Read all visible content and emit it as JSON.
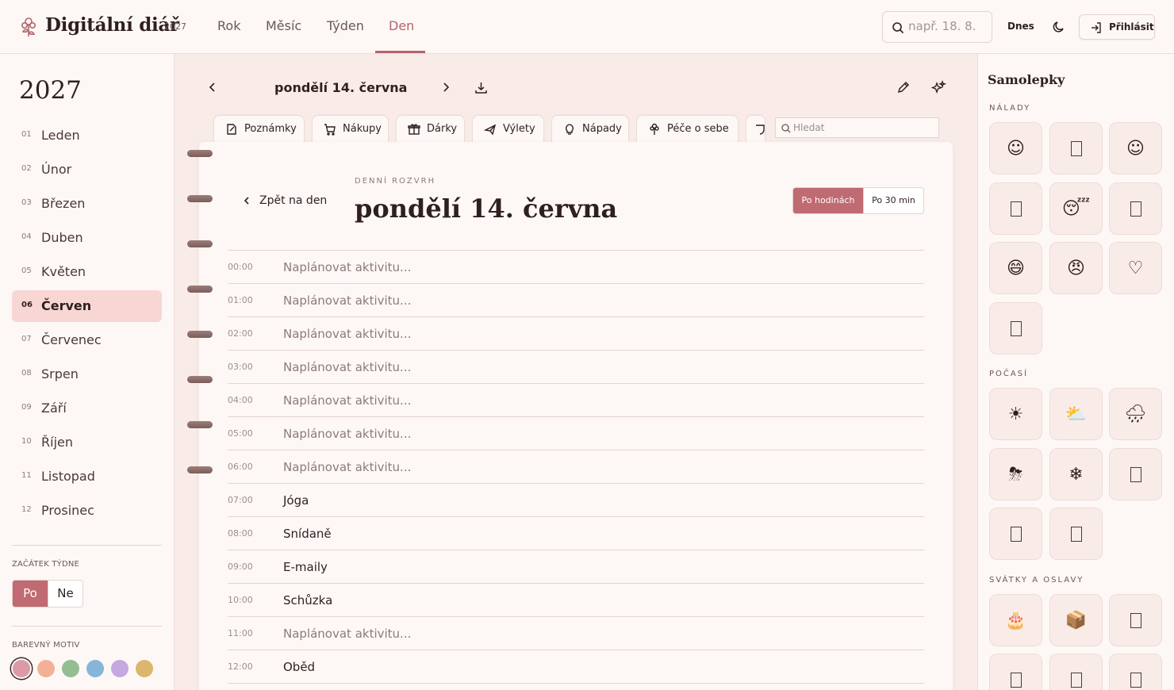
{
  "app": {
    "title": "Digitální diář",
    "year_badge": "2027",
    "nav": [
      "Rok",
      "Měsíc",
      "Týden",
      "Den"
    ],
    "active_nav": "Den",
    "search_placeholder": "např. 18. 8.",
    "today_label": "Dnes",
    "login_label": "Přihlásit"
  },
  "sidebar": {
    "year": "2027",
    "months": [
      {
        "num": "01",
        "name": "Leden"
      },
      {
        "num": "02",
        "name": "Únor"
      },
      {
        "num": "03",
        "name": "Březen"
      },
      {
        "num": "04",
        "name": "Duben"
      },
      {
        "num": "05",
        "name": "Květen"
      },
      {
        "num": "06",
        "name": "Červen"
      },
      {
        "num": "07",
        "name": "Červenec"
      },
      {
        "num": "08",
        "name": "Srpen"
      },
      {
        "num": "09",
        "name": "Září"
      },
      {
        "num": "10",
        "name": "Říjen"
      },
      {
        "num": "11",
        "name": "Listopad"
      },
      {
        "num": "12",
        "name": "Prosinec"
      }
    ],
    "active_month": "Červen",
    "week_start_label": "ZAČÁTEK TÝDNE",
    "week_start_options": [
      "Po",
      "Ne"
    ],
    "week_start_selected": "Po",
    "theme_label": "BAREVNÝ MOTIV",
    "theme_colors": [
      "#dc9aa4",
      "#f3b096",
      "#94bd92",
      "#85b6d9",
      "#c4a8df",
      "#dcb66c"
    ],
    "theme_selected": "#dc9aa4"
  },
  "main": {
    "date_header": "pondělí 14. června",
    "tabs": [
      {
        "label": "Poznámky",
        "icon": "note-icon"
      },
      {
        "label": "Nákupy",
        "icon": "cart-icon"
      },
      {
        "label": "Dárky",
        "icon": "gift-icon"
      },
      {
        "label": "Výlety",
        "icon": "plane-icon"
      },
      {
        "label": "Nápady",
        "icon": "bulb-icon"
      },
      {
        "label": "Péče o sebe",
        "icon": "flower-icon"
      }
    ],
    "tab_search_placeholder": "Hledat",
    "back_label": "Zpět na den",
    "eyebrow": "DENNÍ ROZVRH",
    "big_date": "pondělí 14. června",
    "slot_options": [
      "Po hodinách",
      "Po 30 min"
    ],
    "slot_selected": "Po hodinách",
    "schedule": [
      {
        "time": "00:00",
        "text": "Naplánovat aktivitu...",
        "filled": false
      },
      {
        "time": "01:00",
        "text": "Naplánovat aktivitu...",
        "filled": false
      },
      {
        "time": "02:00",
        "text": "Naplánovat aktivitu...",
        "filled": false
      },
      {
        "time": "03:00",
        "text": "Naplánovat aktivitu...",
        "filled": false
      },
      {
        "time": "04:00",
        "text": "Naplánovat aktivitu...",
        "filled": false
      },
      {
        "time": "05:00",
        "text": "Naplánovat aktivitu...",
        "filled": false
      },
      {
        "time": "06:00",
        "text": "Naplánovat aktivitu...",
        "filled": false
      },
      {
        "time": "07:00",
        "text": "Jóga",
        "filled": true
      },
      {
        "time": "08:00",
        "text": "Snídaně",
        "filled": true
      },
      {
        "time": "09:00",
        "text": "E-maily",
        "filled": true
      },
      {
        "time": "10:00",
        "text": "Schůzka",
        "filled": true
      },
      {
        "time": "11:00",
        "text": "Naplánovat aktivitu...",
        "filled": false
      },
      {
        "time": "12:00",
        "text": "Oběd",
        "filled": true
      }
    ]
  },
  "stickers": {
    "title": "Samolepky",
    "sections": [
      {
        "label": "NÁLADY",
        "items": [
          "☺",
          "□",
          "☺",
          "□",
          "😴",
          "□",
          "😄",
          "😠",
          "♡",
          "□"
        ]
      },
      {
        "label": "POČASÍ",
        "items": [
          "☀",
          "⛅",
          "🌧",
          "⛈",
          "❄",
          "□",
          "□",
          "□"
        ]
      },
      {
        "label": "SVÁTKY A OSLAVY",
        "items": [
          "🎂",
          "📦",
          "□",
          "□",
          "□",
          "□"
        ]
      }
    ]
  }
}
